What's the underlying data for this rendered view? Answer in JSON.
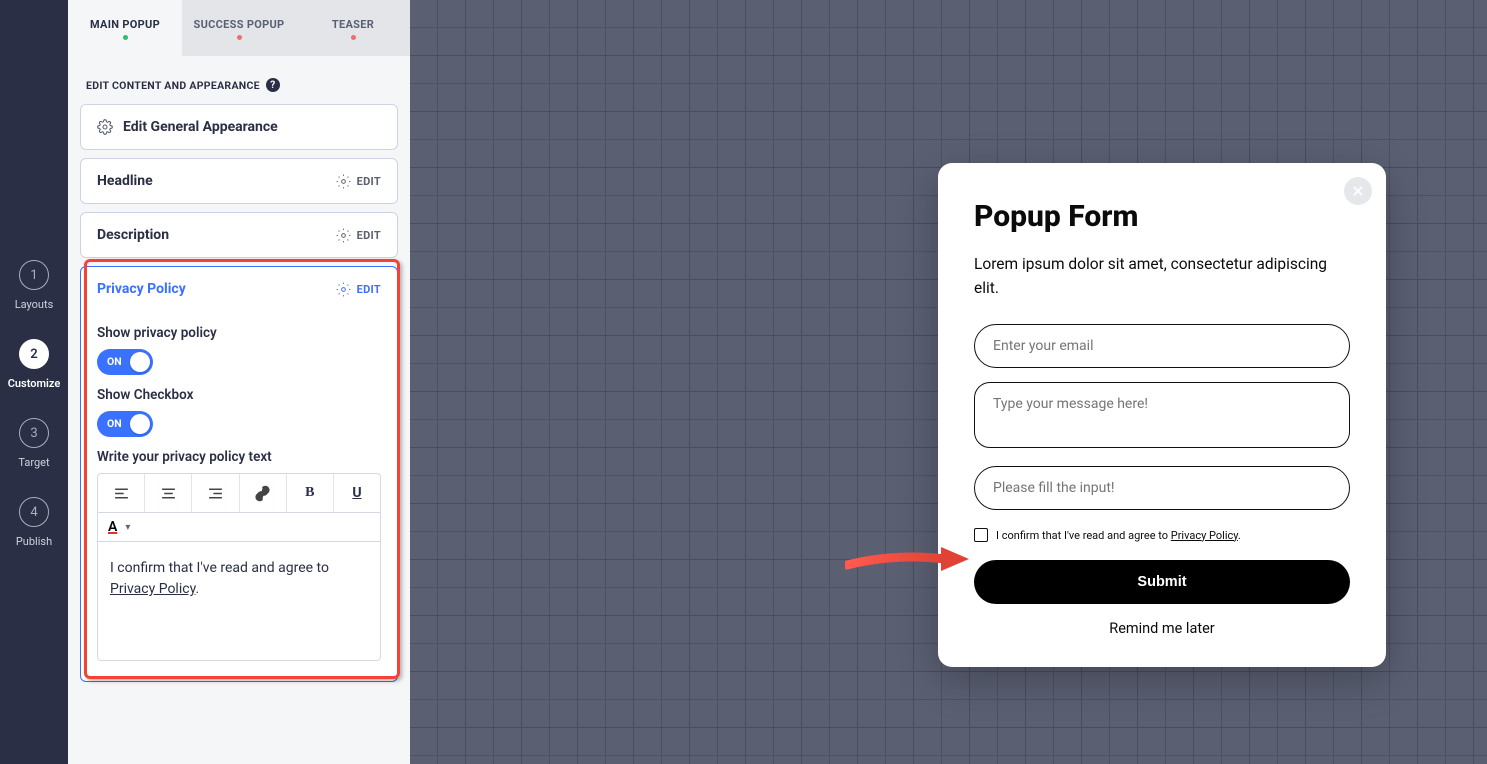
{
  "steps": [
    {
      "num": "1",
      "label": "Layouts"
    },
    {
      "num": "2",
      "label": "Customize"
    },
    {
      "num": "3",
      "label": "Target"
    },
    {
      "num": "4",
      "label": "Publish"
    }
  ],
  "tabs": [
    {
      "label": "MAIN POPUP"
    },
    {
      "label": "SUCCESS POPUP"
    },
    {
      "label": "TEASER"
    }
  ],
  "section_head": "EDIT CONTENT AND APPEARANCE",
  "cards": {
    "general": "Edit General Appearance",
    "headline": "Headline",
    "description": "Description",
    "privacy": "Privacy Policy"
  },
  "edit_label": "EDIT",
  "privacy_fields": {
    "show_pp": "Show privacy policy",
    "show_cb": "Show Checkbox",
    "on": "ON",
    "write": "Write your privacy policy text",
    "text_before": "I confirm that I've read and agree to ",
    "text_link": "Privacy Policy",
    "text_after": "."
  },
  "popup": {
    "title": "Popup Form",
    "desc": "Lorem ipsum dolor sit amet, consectetur adipiscing elit.",
    "email_ph": "Enter your email",
    "msg_ph": "Type your message here!",
    "input3_ph": "Please fill the input!",
    "pp_before": "I confirm that I've read and agree to ",
    "pp_link": "Privacy Policy",
    "pp_after": ".",
    "submit": "Submit",
    "remind": "Remind me later"
  }
}
